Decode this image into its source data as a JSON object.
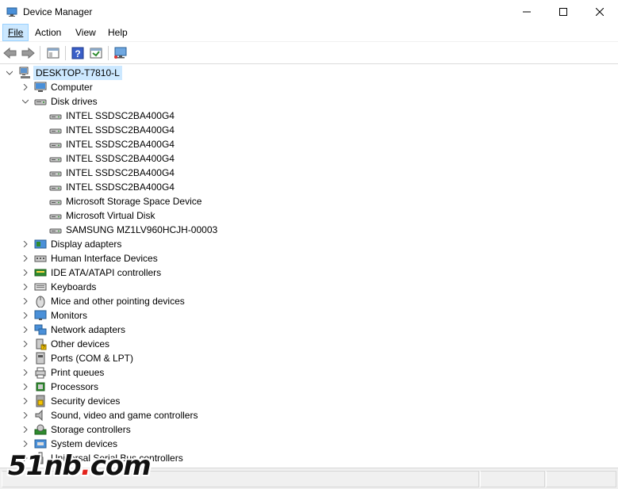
{
  "window": {
    "title": "Device Manager"
  },
  "menu": [
    {
      "label": "File",
      "active": true
    },
    {
      "label": "Action"
    },
    {
      "label": "View"
    },
    {
      "label": "Help"
    }
  ],
  "tree": {
    "root": "DESKTOP-T7810-L",
    "categories": [
      "Computer",
      "Disk drives",
      "Display adapters",
      "Human Interface Devices",
      "IDE ATA/ATAPI controllers",
      "Keyboards",
      "Mice and other pointing devices",
      "Monitors",
      "Network adapters",
      "Other devices",
      "Ports (COM & LPT)",
      "Print queues",
      "Processors",
      "Security devices",
      "Sound, video and game controllers",
      "Storage controllers",
      "System devices",
      "Universal Serial Bus controllers"
    ],
    "disk_drives": [
      "INTEL SSDSC2BA400G4",
      "INTEL SSDSC2BA400G4",
      "INTEL SSDSC2BA400G4",
      "INTEL SSDSC2BA400G4",
      "INTEL SSDSC2BA400G4",
      "INTEL SSDSC2BA400G4",
      "Microsoft Storage Space Device",
      "Microsoft Virtual Disk",
      "SAMSUNG MZ1LV960HCJH-00003"
    ]
  },
  "watermark": {
    "text_main": "51nb",
    "text_dot": ".",
    "text_tail": "com"
  }
}
